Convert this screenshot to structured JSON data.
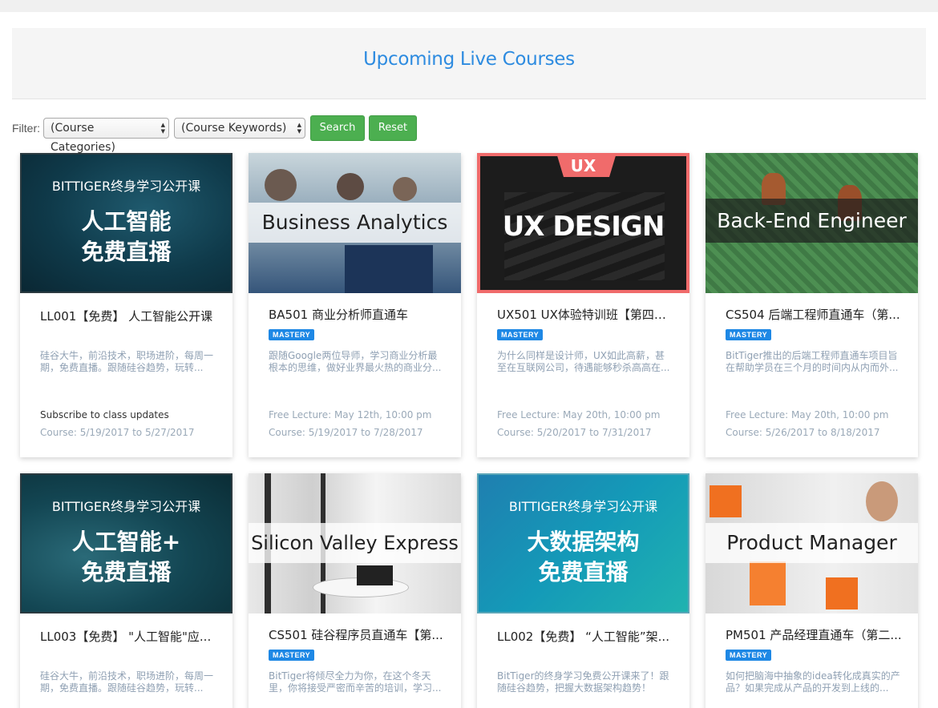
{
  "page_title": "Upcoming Live Courses",
  "filter": {
    "label": "Filter:",
    "category_value": "(Course Categories)",
    "keyword_value": "(Course Keywords)",
    "search_label": "Search",
    "reset_label": "Reset"
  },
  "colors": {
    "accent": "#2d8be0",
    "button_green": "#4caf50",
    "badge_blue": "#1e88e5"
  },
  "courses": [
    {
      "image_line1": "BITTIGER终身学习公开课",
      "image_line2": "人工智能",
      "image_line3": "免费直播",
      "title": "LL001【免费】 人工智能公开课",
      "badge": "",
      "desc": "硅谷大牛，前沿技术，职场进阶，每周一期，免费直播。跟随硅谷趋势，玩转...",
      "meta1": "Subscribe to class updates",
      "meta2": "Course: 5/19/2017 to 5/27/2017"
    },
    {
      "image_caption": "Business Analytics",
      "title": "BA501 商业分析师直通车",
      "badge": "MASTERY",
      "desc": "跟随Google两位导师，学习商业分析最根本的思维，做好业界最火热的商业分...",
      "meta1": "Free Lecture: May 12th, 10:00 pm",
      "meta2": "Course: 5/19/2017 to 7/28/2017"
    },
    {
      "image_tag": "UX",
      "image_caption": "UX DESIGN",
      "title": "UX501 UX体验特训班【第四期...",
      "badge": "MASTERY",
      "desc": "为什么同样是设计师，UX如此高薪，甚至在互联网公司，待遇能够秒杀高高在...",
      "meta1": "Free Lecture: May 20th, 10:00 pm",
      "meta2": "Course: 5/20/2017 to 7/31/2017"
    },
    {
      "image_caption": "Back-End Engineer",
      "title": "CS504 后端工程师直通车（第...",
      "badge": "MASTERY",
      "desc": "BitTiger推出的后端工程师直通车项目旨在帮助学员在三个月的时间内从内而外...",
      "meta1": "Free Lecture: May 20th, 10:00 pm",
      "meta2": "Course: 5/26/2017 to 8/18/2017"
    },
    {
      "image_line1": "BITTIGER终身学习公开课",
      "image_line2": "人工智能+",
      "image_line3": "免费直播",
      "title": "LL003【免费】 \"人工智能\"应...",
      "badge": "",
      "desc": "硅谷大牛，前沿技术，职场进阶，每周一期，免费直播。跟随硅谷趋势，玩转..."
    },
    {
      "image_caption": "Silicon Valley Express",
      "title": "CS501 硅谷程序员直通车【第...",
      "badge": "MASTERY",
      "desc": "BitTiger将倾尽全力为你，在这个冬天里，你将接受严密而辛苦的培训，学习..."
    },
    {
      "image_line1": "BITTIGER终身学习公开课",
      "image_line2": "大数据架构",
      "image_line3": "免费直播",
      "title": "LL002【免费】 “人工智能”架...",
      "badge": "",
      "desc": "BitTiger的终身学习免费公开课来了！跟随硅谷趋势，把握大数据架构趋势！"
    },
    {
      "image_caption": "Product Manager",
      "title": "PM501 产品经理直通车（第二...",
      "badge": "MASTERY",
      "desc": "如何把脑海中抽象的idea转化成真实的产品？如果完成从产品的开发到上线的..."
    }
  ]
}
